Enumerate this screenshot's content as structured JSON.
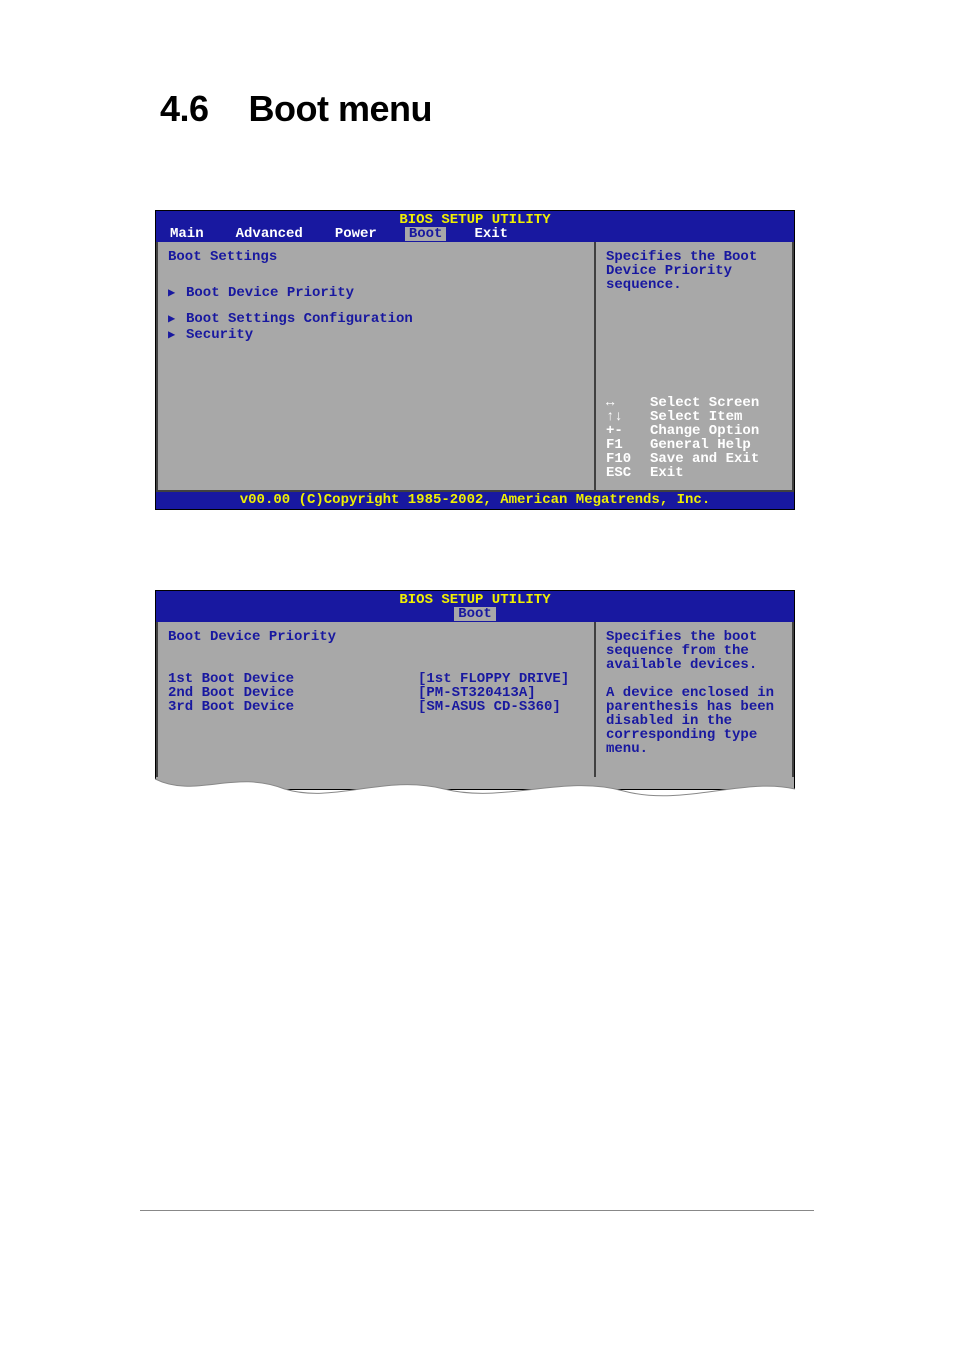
{
  "heading": {
    "number": "4.6",
    "text": "Boot menu"
  },
  "bios1": {
    "title": "BIOS SETUP UTILITY",
    "tabs": [
      "Main",
      "Advanced",
      "Power",
      "Boot",
      "Exit"
    ],
    "selected_tab": "Boot",
    "section": "Boot Settings",
    "items": [
      "Boot Device Priority",
      "Boot Settings Configuration",
      "Security"
    ],
    "help": "Specifies the Boot Device Priority sequence.",
    "keys": [
      {
        "k": "↔",
        "v": "Select Screen"
      },
      {
        "k": "↑↓",
        "v": "Select Item"
      },
      {
        "k": "+-",
        "v": "Change Option"
      },
      {
        "k": "F1",
        "v": "General Help"
      },
      {
        "k": "F10",
        "v": "Save and Exit"
      },
      {
        "k": "ESC",
        "v": "Exit"
      }
    ],
    "footer": "v00.00 (C)Copyright 1985-2002, American Megatrends, Inc."
  },
  "bios2": {
    "title": "BIOS SETUP UTILITY",
    "tab": "Boot",
    "section": "Boot Device Priority",
    "rows": [
      {
        "label": "1st Boot Device",
        "value": "[1st FLOPPY DRIVE]"
      },
      {
        "label": "2nd Boot Device",
        "value": "[PM-ST320413A]"
      },
      {
        "label": "3rd Boot Device",
        "value": "[SM-ASUS CD-S360]"
      }
    ],
    "help1": "Specifies the boot sequence from the available devices.",
    "help2": "A device enclosed in parenthesis has been disabled in the corresponding type menu."
  }
}
